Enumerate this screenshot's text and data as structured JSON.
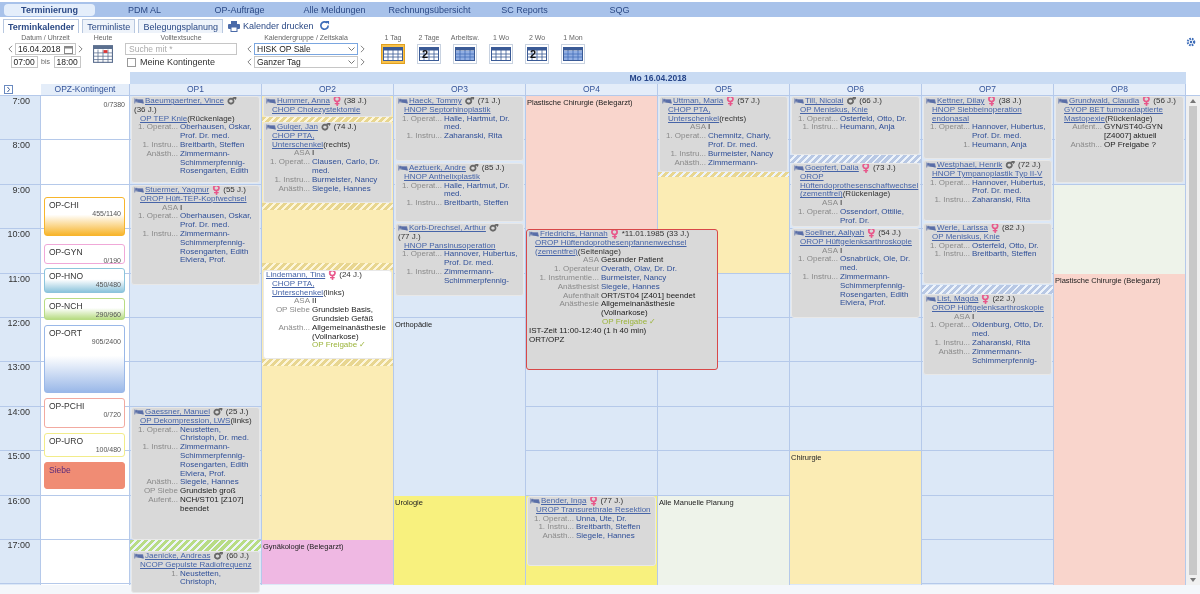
{
  "nav": [
    {
      "label": "Terminierung",
      "selected": true
    },
    {
      "label": "PDM AL",
      "selected": false
    },
    {
      "label": "OP-Aufträge",
      "selected": false
    },
    {
      "label": "Alle Meldungen",
      "selected": false
    },
    {
      "label": "Rechnungsübersicht",
      "selected": false
    },
    {
      "label": "SC Reports",
      "selected": false
    },
    {
      "label": "SQG",
      "selected": false
    }
  ],
  "subtabs": [
    {
      "label": "Terminkalender",
      "selected": true
    },
    {
      "label": "Terminliste",
      "selected": false
    },
    {
      "label": "Belegungsplanung",
      "selected": false
    }
  ],
  "print_label": "Kalender drucken",
  "toolbar": {
    "date_label": "Datum / Uhrzeit",
    "date": "16.04.2018",
    "time_from": "07:00",
    "bis": "bis",
    "time_to": "18:00",
    "today_label": "Heute",
    "search_label": "Volltextsuche",
    "search_placeholder": "Suche mit *",
    "own_label": "Meine Kontingente",
    "own_checked": false,
    "group_label": "Kalendergruppe / Zeitskala",
    "group": "HISK OP Säle",
    "scale": "Ganzer Tag",
    "views": [
      {
        "label": "1 Tag",
        "selected": true
      },
      {
        "label": "2 Tage",
        "selected": false,
        "digit": "2"
      },
      {
        "label": "Arbeitsw.",
        "selected": false
      },
      {
        "label": "1 Wo",
        "selected": false
      },
      {
        "label": "2 Wo",
        "selected": false,
        "digit": "2"
      },
      {
        "label": "1 Mon",
        "selected": false
      }
    ]
  },
  "day_header": "Mo 16.04.2018",
  "hours": [
    "7:00",
    "8:00",
    "9:00",
    "10:00",
    "11:00",
    "12:00",
    "13:00",
    "14:00",
    "15:00",
    "16:00",
    "17:00"
  ],
  "contingent": {
    "title": "OPZ-Kontingent",
    "total": "0/7380",
    "items": [
      {
        "label": "OP-CHI",
        "count": "455/1140",
        "color": "#f7b52c",
        "kind": "gradient"
      },
      {
        "label": "OP-GYN",
        "count": "0/190",
        "color": "#f0a8d8",
        "kind": "outline"
      },
      {
        "label": "OP-HNO",
        "count": "450/480",
        "color": "#8cc4dc",
        "kind": "gradient"
      },
      {
        "label": "OP-NCH",
        "count": "290/960",
        "color": "#b8dc84",
        "kind": "gradient"
      },
      {
        "label": "OP-ORT",
        "count": "905/2400",
        "color": "#9ab8e8",
        "kind": "gradient"
      },
      {
        "label": "OP-PCHI",
        "count": "0/720",
        "color": "#f2aaa0",
        "kind": "outline"
      },
      {
        "label": "OP-URO",
        "count": "100/480",
        "color": "#f2ec8a",
        "kind": "outline"
      },
      {
        "label": "Siebe",
        "color": "#f08c74",
        "kind": "solid"
      }
    ]
  },
  "columns": [
    {
      "title": "OP1",
      "buffers": [
        {
          "color": "#b8dc84"
        }
      ],
      "appointments": [
        {
          "patient": "Baeumgaertner, Vince",
          "sex": {
            "symbol": "♂",
            "color": "#666666"
          },
          "age": "(36 J.)",
          "bed": true,
          "selected": false,
          "color": "#d9d9d9",
          "procedure": "OP TEP Knie",
          "note": "(Rückenlage)",
          "rows": [
            {
              "label": "1. Operat...",
              "value": "Oberhausen, Oskar, Prof. Dr. med.",
              "kind": "person"
            },
            {
              "label": "1. Instru...",
              "value": "Breitbarth, Steffen",
              "kind": "person"
            },
            {
              "label": "Anästh...",
              "value": "Zimmermann-Schimmerpfennig-Rosengarten, Edith",
              "kind": "person"
            }
          ]
        },
        {
          "patient": "Stuermer, Yagmur",
          "sex": {
            "symbol": "♀",
            "color": "#e8568a"
          },
          "age": "(55 J.)",
          "bed": true,
          "selected": false,
          "color": "#d9d9d9",
          "procedure": "OROP Hüft-TEP-Kopfwechsel",
          "rows": [
            {
              "label": "ASA",
              "value": "I",
              "kind": "text"
            },
            {
              "label": "1. Operat...",
              "value": "Oberhausen, Oskar, Prof. Dr. med.",
              "kind": "person"
            },
            {
              "label": "1. Instru...",
              "value": "Zimmermann-Schimmerpfennig-Rosengarten, Edith Elviera, Prof.",
              "kind": "person"
            }
          ]
        },
        {
          "patient": "Gaessner, Manuel",
          "sex": {
            "symbol": "♂",
            "color": "#666666"
          },
          "age": "(25 J.)",
          "bed": true,
          "selected": false,
          "color": "#d9d9d9",
          "procedure": "OP Dekompression, LWS",
          "note": "(links)",
          "rows": [
            {
              "label": "1. Operat...",
              "value": "Neustetten, Christoph, Dr. med.",
              "kind": "person"
            },
            {
              "label": "1. Instru...",
              "value": "Zimmermann-Schimmerpfennig-Rosengarten, Edith Elviera, Prof.",
              "kind": "person"
            },
            {
              "label": "Anästh...",
              "value": "Siegele, Hannes",
              "kind": "person"
            },
            {
              "label": "OP Siebe",
              "value": "Grundsieb groß",
              "kind": "text"
            },
            {
              "label": "Aufent...",
              "value": "NCH/ST01 [Z107] beendet",
              "kind": "text"
            }
          ]
        },
        {
          "patient": "Jaenicke, Andreas",
          "sex": {
            "symbol": "♂",
            "color": "#666666"
          },
          "age": "(60 J.)",
          "bed": true,
          "selected": false,
          "color": "#d9d9d9",
          "procedure": "NCOP Gepulste Radiofrequenz",
          "rows": [
            {
              "label": "1.",
              "value": "Neustetten, Christoph,",
              "kind": "person"
            }
          ]
        }
      ]
    },
    {
      "title": "OP2",
      "blocks": [
        {
          "color": "#fbecb4"
        },
        {
          "label": "Gynäkologie (Belegarzt)",
          "color": "#efb8e3"
        }
      ],
      "buffers": [
        {
          "color": "#e8d690"
        },
        {
          "color": "#e8d690"
        },
        {
          "color": "#e8d690"
        },
        {
          "color": "#e8d690"
        }
      ],
      "appointments": [
        {
          "patient": "Hummer, Anna",
          "sex": {
            "symbol": "♀",
            "color": "#e8568a"
          },
          "age": "(38 J.)",
          "bed": true,
          "selected": false,
          "color": "#d9d9d9",
          "procedure": "CHOP Cholezystektomie"
        },
        {
          "patient": "Gulger, Jan",
          "sex": {
            "symbol": "♂",
            "color": "#666666"
          },
          "age": "(74 J.)",
          "bed": true,
          "selected": false,
          "color": "#d9d9d9",
          "procedure": "CHOP PTA, Unterschenkel",
          "note": "(rechts)",
          "rows": [
            {
              "label": "ASA",
              "value": "I",
              "kind": "text"
            },
            {
              "label": "1. Operat...",
              "value": "Clausen, Carlo, Dr. med.",
              "kind": "person"
            },
            {
              "label": "1. Instru...",
              "value": "Burmeister, Nancy",
              "kind": "person"
            },
            {
              "label": "Anästh...",
              "value": "Siegele, Hannes",
              "kind": "person"
            }
          ]
        },
        {
          "patient": "Lindemann, Tina",
          "sex": {
            "symbol": "♀",
            "color": "#e8568a"
          },
          "age": "(24 J.)",
          "bed": false,
          "selected": false,
          "color": "#ffffff",
          "procedure": "CHOP PTA, Unterschenkel",
          "note": "(links)",
          "rows": [
            {
              "label": "ASA",
              "value": "II",
              "kind": "text"
            },
            {
              "label": "OP Siebe",
              "value": "Grundsieb Basis, Grundsieb Gefäß",
              "kind": "text"
            },
            {
              "label": "Anästh...",
              "value": "Allgemeinanästhesie (Vollnarkose)",
              "kind": "text"
            }
          ],
          "release": "OP Freigabe ✓"
        }
      ]
    },
    {
      "title": "OP3",
      "blocks": [
        {
          "label": "Orthopädie",
          "color": "#dce8f7"
        },
        {
          "label": "Urologie",
          "color": "#f8f17e"
        }
      ],
      "appointments": [
        {
          "patient": "Haeck, Tommy",
          "sex": {
            "symbol": "♂",
            "color": "#666666"
          },
          "age": "(71 J.)",
          "bed": true,
          "selected": false,
          "color": "#d9d9d9",
          "procedure": "HNOP Septorhinoplastik",
          "rows": [
            {
              "label": "1. Operat...",
              "value": "Halle, Hartmut, Dr. med.",
              "kind": "person"
            },
            {
              "label": "1. Instru...",
              "value": "Zaharanski, Rita",
              "kind": "person"
            }
          ]
        },
        {
          "patient": "Aeztuerk, Andre",
          "sex": {
            "symbol": "♂",
            "color": "#666666"
          },
          "age": "(85 J.)",
          "bed": true,
          "selected": false,
          "color": "#d9d9d9",
          "procedure": "HNOP Anthelixplastik",
          "rows": [
            {
              "label": "1. Operat...",
              "value": "Halle, Hartmut, Dr. med.",
              "kind": "person"
            },
            {
              "label": "1. Instru...",
              "value": "Breitbarth, Steffen",
              "kind": "person"
            }
          ]
        },
        {
          "patient": "Korb-Drechsel, Arthur",
          "sex": {
            "symbol": "♂",
            "color": "#666666"
          },
          "age": "(77 J.)",
          "bed": true,
          "selected": false,
          "color": "#d9d9d9",
          "procedure": "HNOP Pansinusoperation",
          "rows": [
            {
              "label": "1. Operat...",
              "value": "Hannover, Hubertus, Prof. Dr. med.",
              "kind": "person"
            },
            {
              "label": "1. Instru...",
              "value": "Zimmermann-Schimmerpfennig-",
              "kind": "person"
            }
          ]
        }
      ]
    },
    {
      "title": "OP4",
      "blocks": [
        {
          "label": "Plastische Chirurgie (Belegarzt)",
          "color": "#f9d5cc"
        },
        {
          "color": "#f8f17e"
        }
      ],
      "appointments": [
        {
          "patient": "Friedrichs, Hannah",
          "sex": {
            "symbol": "♀",
            "color": "#e8568a"
          },
          "age": "*11.01.1985 (33 J.)",
          "bed": true,
          "selected": true,
          "color": "#d9d9d9",
          "procedure": "OROP Hüftendoprothesenpfannenwechsel (zementfrei)",
          "note": "(Seitenlage)",
          "rows": [
            {
              "label": "ASA",
              "value": "Gesunder Patient",
              "kind": "text"
            },
            {
              "label": "1. Operateur",
              "value": "Overath, Olav, Dr. Dr.",
              "kind": "person"
            },
            {
              "label": "1. Instrumentie...",
              "value": "Burmeister, Nancy",
              "kind": "person"
            },
            {
              "label": "Anästhesist",
              "value": "Siegele, Hannes",
              "kind": "person"
            },
            {
              "label": "Aufenthalt",
              "value": "ORT/ST04 [Z401] beendet",
              "kind": "text"
            },
            {
              "label": "Anästhesie",
              "value": "Allgemeinanästhesie (Vollnarkose)",
              "kind": "text"
            }
          ],
          "release": "OP Freigabe ✓",
          "footer": [
            "IST-Zeit 11:00-12:40 (1 h 40 min)",
            "ORT/OPZ"
          ]
        },
        {
          "patient": "Bender, Inga",
          "sex": {
            "symbol": "♀",
            "color": "#e8568a"
          },
          "age": "(77 J.)",
          "bed": true,
          "selected": false,
          "color": "#d9d9d9",
          "procedure": "UROP Transurethrale Resektion",
          "rows": [
            {
              "label": "1. Operat...",
              "value": "Unna, Ute, Dr.",
              "kind": "person"
            },
            {
              "label": "1. Instru...",
              "value": "Breitbarth, Steffen",
              "kind": "person"
            },
            {
              "label": "Anästh...",
              "value": "Siegele, Hannes",
              "kind": "person"
            }
          ]
        }
      ]
    },
    {
      "title": "OP5",
      "blocks": [
        {
          "color": "#fbecb4"
        },
        {
          "label": "Alle Manuelle Planung",
          "color": "#eef3ea"
        }
      ],
      "buffers": [
        {
          "color": "#e8d690"
        }
      ],
      "appointments": [
        {
          "patient": "Uttman, Maria",
          "sex": {
            "symbol": "♀",
            "color": "#e8568a"
          },
          "age": "(57 J.)",
          "bed": true,
          "selected": false,
          "color": "#d9d9d9",
          "procedure": "CHOP PTA, Unterschenkel",
          "note": "(rechts)",
          "rows": [
            {
              "label": "ASA",
              "value": "I",
              "kind": "text"
            },
            {
              "label": "1. Operat...",
              "value": "Chemnitz, Charly, Prof. Dr. med.",
              "kind": "person"
            },
            {
              "label": "1. Instru...",
              "value": "Burmeister, Nancy",
              "kind": "person"
            },
            {
              "label": "Anästh...",
              "value": "Zimmermann-",
              "kind": "person"
            }
          ]
        }
      ]
    },
    {
      "title": "OP6",
      "blocks": [
        {
          "label": "Chirurgie",
          "color": "#fbecb4"
        }
      ],
      "buffers": [
        {
          "color": "#b8c8e4"
        }
      ],
      "appointments": [
        {
          "patient": "Till, Nicolai",
          "sex": {
            "symbol": "♂",
            "color": "#666666"
          },
          "age": "(66 J.)",
          "bed": true,
          "selected": false,
          "color": "#d9d9d9",
          "procedure": "OP Meniskus, Knie",
          "rows": [
            {
              "label": "1. Operat...",
              "value": "Osterfeld, Otto, Dr.",
              "kind": "person"
            },
            {
              "label": "1. Instru...",
              "value": "Heumann, Anja",
              "kind": "person"
            }
          ]
        },
        {
          "patient": "Goepfert, Dalia",
          "sex": {
            "symbol": "♀",
            "color": "#e8568a"
          },
          "age": "(73 J.)",
          "bed": true,
          "selected": false,
          "color": "#d9d9d9",
          "procedure": "OROP Hüftendoprothesenschaftwechsel (zementfrei)",
          "note": "(Rückenlage)",
          "rows": [
            {
              "label": "ASA",
              "value": "I",
              "kind": "text"
            },
            {
              "label": "1. Operat...",
              "value": "Ossendorf, Ottilie, Prof. Dr.",
              "kind": "person"
            }
          ]
        },
        {
          "patient": "Soellner, Aaliyah",
          "sex": {
            "symbol": "♀",
            "color": "#e8568a"
          },
          "age": "(54 J.)",
          "bed": true,
          "selected": false,
          "color": "#d9d9d9",
          "procedure": "OROP Hüftgelenksarthroskopie",
          "rows": [
            {
              "label": "ASA",
              "value": "I",
              "kind": "text"
            },
            {
              "label": "1. Operat...",
              "value": "Osnabrück, Ole, Dr. med.",
              "kind": "person"
            },
            {
              "label": "1. Instru...",
              "value": "Zimmermann-Schimmerpfennig-Rosengarten, Edith Elviera, Prof.",
              "kind": "person"
            }
          ]
        }
      ]
    },
    {
      "title": "OP7",
      "buffers": [
        {
          "color": "#b8c8e4"
        }
      ],
      "appointments": [
        {
          "patient": "Kettner, Dilay",
          "sex": {
            "symbol": "♀",
            "color": "#e8568a"
          },
          "age": "(38 J.)",
          "bed": true,
          "selected": false,
          "color": "#d9d9d9",
          "procedure": "HNOP Siebbeinoperation endonasal",
          "rows": [
            {
              "label": "1. Operat...",
              "value": "Hannover, Hubertus, Prof. Dr. med.",
              "kind": "person"
            },
            {
              "label": "1.",
              "value": "Heumann, Anja",
              "kind": "person"
            }
          ]
        },
        {
          "patient": "Westphael, Henrik",
          "sex": {
            "symbol": "♂",
            "color": "#666666"
          },
          "age": "(72 J.)",
          "bed": true,
          "selected": false,
          "color": "#d9d9d9",
          "procedure": "HNOP Tympanoplastik Typ II-V",
          "rows": [
            {
              "label": "1. Operat...",
              "value": "Hannover, Hubertus, Prof. Dr. med.",
              "kind": "person"
            },
            {
              "label": "1. Instru...",
              "value": "Zaharanski, Rita",
              "kind": "person"
            }
          ]
        },
        {
          "patient": "Werle, Larissa",
          "sex": {
            "symbol": "♀",
            "color": "#e8568a"
          },
          "age": "(82 J.)",
          "bed": true,
          "selected": false,
          "color": "#d9d9d9",
          "procedure": "OP Meniskus, Knie",
          "rows": [
            {
              "label": "1. Operat...",
              "value": "Osterfeld, Otto, Dr.",
              "kind": "person"
            },
            {
              "label": "1. Instru...",
              "value": "Breitbarth, Steffen",
              "kind": "person"
            }
          ]
        },
        {
          "patient": "List, Magda",
          "sex": {
            "symbol": "♀",
            "color": "#e8568a"
          },
          "age": "(22 J.)",
          "bed": true,
          "selected": false,
          "color": "#d9d9d9",
          "procedure": "OROP Hüftgelenksarthroskopie",
          "rows": [
            {
              "label": "ASA",
              "value": "I",
              "kind": "text"
            },
            {
              "label": "1. Operat...",
              "value": "Oldenburg, Otto, Dr. med.",
              "kind": "person"
            },
            {
              "label": "1. Instru...",
              "value": "Zaharanski, Rita",
              "kind": "person"
            },
            {
              "label": "Anästh...",
              "value": "Zimmermann-Schimmerpfennig-",
              "kind": "person"
            }
          ]
        }
      ]
    },
    {
      "title": "OP8",
      "blocks": [
        {
          "color": "#eef3ea"
        },
        {
          "label": "Plastische Chirurgie (Belegarzt)",
          "color": "#f9d5cc"
        }
      ],
      "appointments": [
        {
          "patient": "Grundwald, Claudia",
          "sex": {
            "symbol": "♀",
            "color": "#e8568a"
          },
          "age": "(56 J.)",
          "bed": true,
          "selected": false,
          "color": "#d9d9d9",
          "procedure": "GYOP BET tumoradaptierte Mastopexie",
          "note": "(Rückenlage)",
          "rows": [
            {
              "label": "Aufent...",
              "value": "GYN/ST40-GYN [Z4007] aktuell",
              "kind": "text"
            },
            {
              "label": "Anästh...",
              "value": "OP Freigabe ?",
              "kind": "text"
            }
          ]
        }
      ]
    }
  ]
}
